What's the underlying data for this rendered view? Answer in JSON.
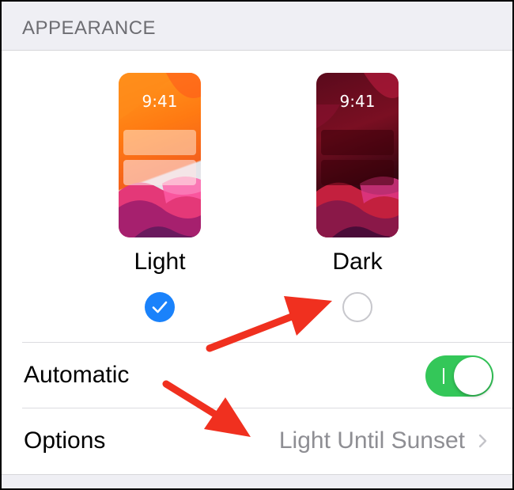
{
  "section": {
    "header": "APPEARANCE"
  },
  "appearance": {
    "light": {
      "label": "Light",
      "time": "9:41",
      "selected": true
    },
    "dark": {
      "label": "Dark",
      "time": "9:41",
      "selected": false
    }
  },
  "automatic": {
    "label": "Automatic",
    "enabled": true
  },
  "options": {
    "label": "Options",
    "value": "Light Until Sunset"
  },
  "colors": {
    "accent_blue": "#1a82fb",
    "toggle_green": "#34c759",
    "annotation_red": "#f0301f"
  }
}
